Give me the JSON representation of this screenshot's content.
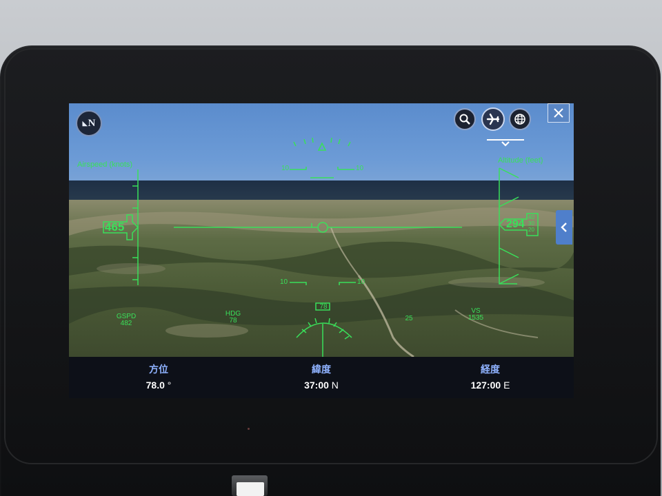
{
  "hud": {
    "airspeed_label": "Airspeed (knots)",
    "altitude_label": "Altitude (feet)",
    "airspeed_value": "465",
    "altitude_value": "294",
    "pitch_scale": [
      "10",
      "10",
      "10",
      "10"
    ],
    "heading_box": "78",
    "gspd_label": "GSPD",
    "gspd_value": "482",
    "hdg_label": "HDG",
    "hdg_value": "78",
    "vs_label": "VS",
    "vs_value": "1535",
    "bank_marker": "25",
    "altitude_roller": [
      "40",
      "30",
      "20"
    ]
  },
  "controls": {
    "north": "N",
    "search_icon": "magnifier",
    "plane_icon": "airplane",
    "globe_icon": "globe",
    "close_icon": "close-x"
  },
  "info": {
    "heading_label": "方位",
    "heading_value": "78.0",
    "heading_unit": "°",
    "latitude_label": "緯度",
    "latitude_value": "37:00",
    "latitude_unit": "N",
    "longitude_label": "経度",
    "longitude_value": "127:00",
    "longitude_unit": "E"
  },
  "colors": {
    "hud_green": "#39e05a",
    "sky": "#6c9bd6",
    "info_label": "#8fb2ff"
  }
}
